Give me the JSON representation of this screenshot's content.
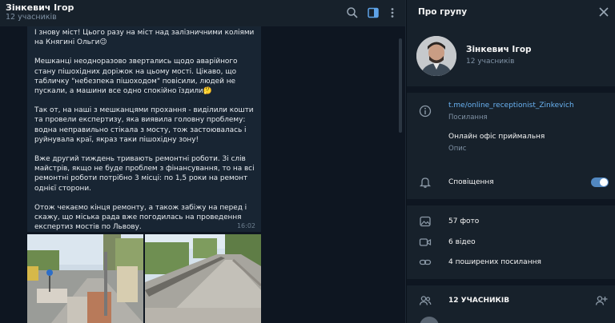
{
  "chat": {
    "title": "Зінкевич Ігор",
    "subtitle": "12 учасників",
    "header_icons": [
      "search-icon",
      "sidebar-toggle-icon",
      "more-vert-icon"
    ],
    "message": {
      "text": "І знову міст! Цього разу на міст над залізничними коліями на Княгині Ольги😉\n\nМешканці неодноразово звертались щодо аварійного стану пішохідних доріжок на цьому мості. Цікаво, що табличку \"небезпека пішоходом\" повісили, людей не пускали, а машини все одно спокійно їздили🤔\n\nТак от, на наші з мешканцями прохання - виділили кошти та провели експертизу, яка виявила головну проблему: водна неправильно стікала з мосту, тож застоювалась і руйнувала краї, якраз таки пішохідну зону!\n\nВже другий тиждень тривають ремонтні роботи. Зі слів майстрів, якщо не буде проблем з фінансування, то на всі ремонтні роботи потрібно 3 місці: по 1,5 роки на ремонт однієї сторони.\n\nОтож чекаємо кінця ремонту, а також забіжу на перед і скажу, що міська рада вже погодилась на проведення експертиз мостів по Львову.",
      "time": "16:02"
    }
  },
  "info": {
    "title": "Про групу",
    "profile": {
      "name": "Зінкевич Ігор",
      "subtitle": "12 учасників"
    },
    "link": {
      "value": "t.me/online_receptionist_Zinkevich",
      "label": "Посилання"
    },
    "description": {
      "value": "Онлайн офіс приймальня",
      "label": "Опис"
    },
    "notifications": {
      "label": "Сповіщення",
      "enabled": true
    },
    "media": {
      "photos": "57 фото",
      "videos": "6 відео",
      "links": "4 поширених посилання"
    },
    "members": {
      "header": "12 УЧАСНИКІВ"
    }
  },
  "colors": {
    "accent": "#6ab3f3",
    "toggle": "#5288c1",
    "panel": "#17212b",
    "chat_bg": "#0e1621",
    "bubble": "#182533"
  }
}
